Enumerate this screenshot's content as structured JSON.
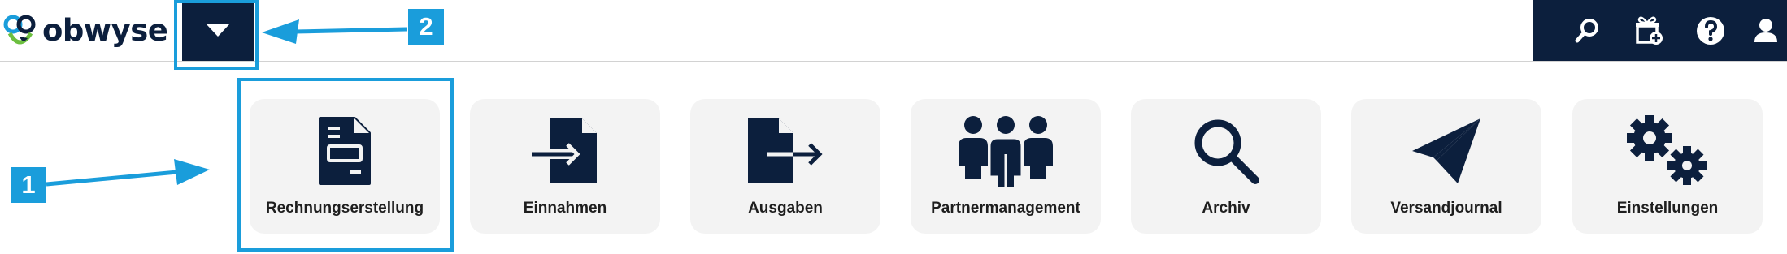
{
  "header": {
    "logo_text": "obwyse",
    "menu_toggle_icon": "caret-down-icon",
    "right_icons": [
      "search-icon",
      "add-gift-icon",
      "help-icon",
      "user-icon"
    ]
  },
  "annotations": {
    "badge_1": "1",
    "badge_2": "2",
    "color": "#1a9ddb"
  },
  "tiles": [
    {
      "label": "Rechnungserstellung",
      "icon": "invoice-icon"
    },
    {
      "label": "Einnahmen",
      "icon": "file-import-icon"
    },
    {
      "label": "Ausgaben",
      "icon": "file-export-icon"
    },
    {
      "label": "Partnermanagement",
      "icon": "people-group-icon"
    },
    {
      "label": "Archiv",
      "icon": "magnifier-icon"
    },
    {
      "label": "Versandjournal",
      "icon": "paper-plane-icon"
    },
    {
      "label": "Einstellungen",
      "icon": "gears-icon"
    }
  ],
  "colors": {
    "navy": "#0c1f3d",
    "tile_bg": "#f3f3f3",
    "accent_blue": "#1a9ddb"
  }
}
